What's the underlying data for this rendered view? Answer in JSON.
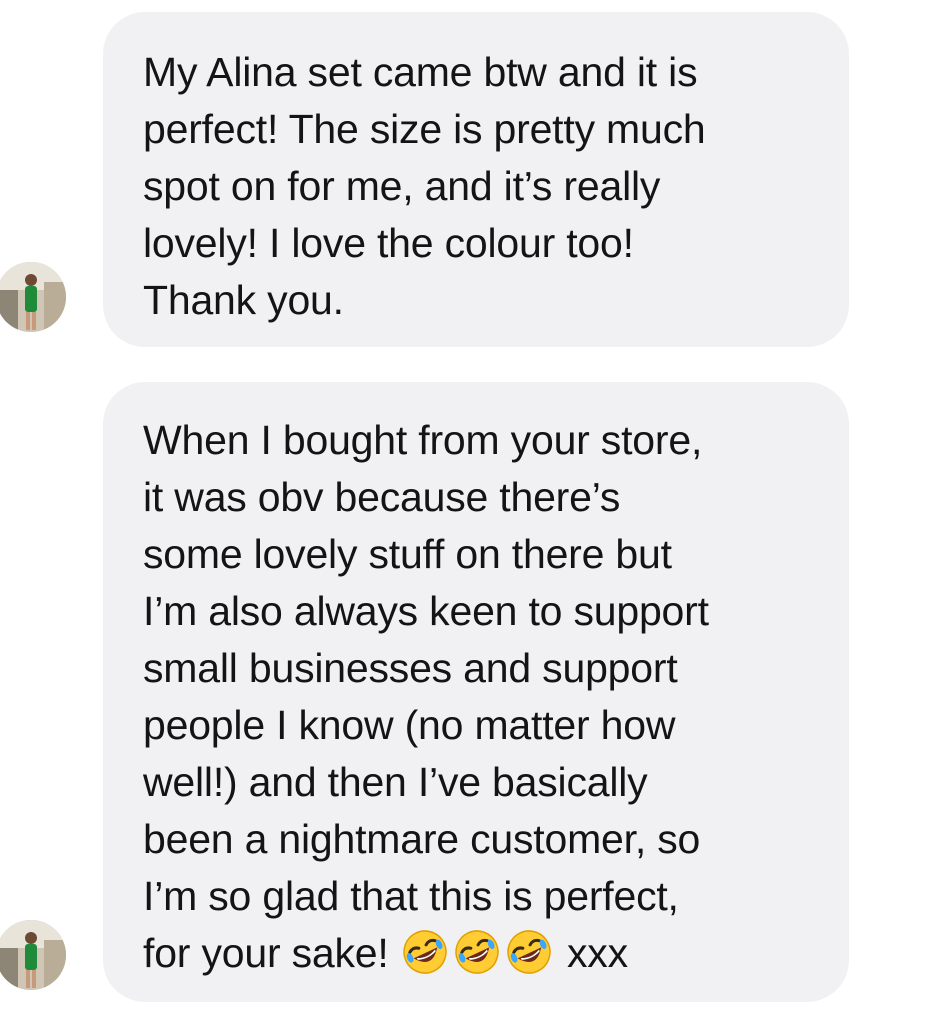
{
  "conversation": {
    "messages": [
      {
        "lines": [
          "My Alina set came btw and it is",
          "perfect! The size is pretty much",
          "spot on for me, and it’s really",
          "lovely! I love the colour too!",
          "Thank you."
        ]
      },
      {
        "lines": [
          "When I bought from your store,",
          "it was obv because there’s",
          "some lovely stuff on there but",
          "I’m also always keen to support",
          "small businesses and support",
          "people I know (no matter how",
          "well!) and then I’ve basically",
          "been a nightmare customer, so",
          "I’m so glad that this is perfect,"
        ],
        "last_line_text": "for your sake!",
        "emojis": [
          "rolling-on-floor-laughing-emoji",
          "rolling-on-floor-laughing-emoji",
          "rolling-on-floor-laughing-emoji"
        ],
        "last_line_suffix": "xxx"
      }
    ]
  },
  "colors": {
    "bubble_background": "#f1f1f3",
    "text": "#141414",
    "page_background": "#ffffff"
  }
}
